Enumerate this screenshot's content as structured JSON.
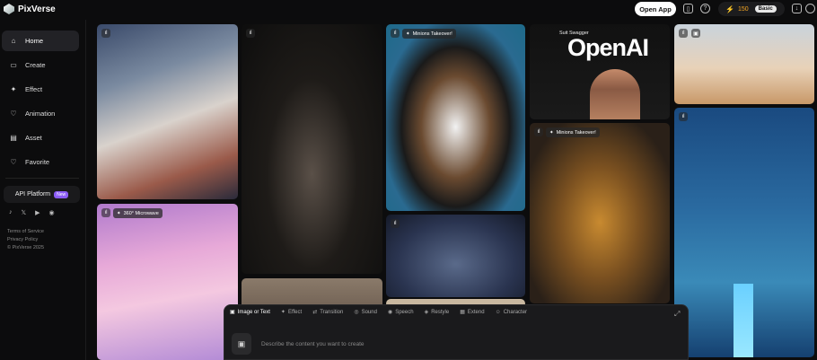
{
  "app": {
    "name": "PixVerse"
  },
  "header": {
    "open_app": "Open App",
    "credits": "150",
    "plan": "Basic"
  },
  "sidebar": {
    "items": [
      {
        "label": "Home",
        "icon": "home-icon",
        "glyph": "⌂"
      },
      {
        "label": "Create",
        "icon": "video-icon",
        "glyph": "▭"
      },
      {
        "label": "Effect",
        "icon": "sparkle-icon",
        "glyph": "✦"
      },
      {
        "label": "Animation",
        "icon": "heart-icon",
        "glyph": "♡"
      },
      {
        "label": "Asset",
        "icon": "folder-icon",
        "glyph": "▤"
      },
      {
        "label": "Favorite",
        "icon": "heart-icon",
        "glyph": "♡"
      }
    ],
    "api_platform": "API Platform",
    "new_badge": "New",
    "socials": [
      "♪",
      "𝕏",
      "▶",
      "◉"
    ],
    "terms": "Terms of Service",
    "privacy": "Privacy Policy",
    "copyright": "© PixVerse 2025"
  },
  "tiles": {
    "minions1": "Minions Takeover!",
    "microwave": "360° Microwave",
    "suit": "Suit Swagger",
    "openai": "OpenAI",
    "minions2": "Minions Takeover!"
  },
  "composer": {
    "tabs": [
      {
        "label": "Image or Text",
        "glyph": "▣"
      },
      {
        "label": "Effect",
        "glyph": "✦"
      },
      {
        "label": "Transition",
        "glyph": "⇄"
      },
      {
        "label": "Sound",
        "glyph": "◎"
      },
      {
        "label": "Speech",
        "glyph": "◉"
      },
      {
        "label": "Restyle",
        "glyph": "◈"
      },
      {
        "label": "Extend",
        "glyph": "▦"
      },
      {
        "label": "Character",
        "glyph": "☺"
      }
    ],
    "placeholder": "Describe the content you want to create"
  },
  "colors": {
    "accent": "#8b5cf6",
    "credit": "#f5a623",
    "background": "#0c0c0d"
  }
}
